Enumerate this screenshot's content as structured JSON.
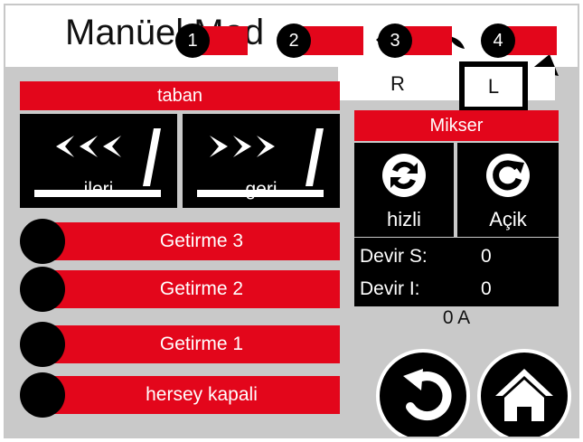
{
  "header": {
    "title": "Manüel Mod",
    "tabs": [
      {
        "label": "1"
      },
      {
        "label": "2"
      },
      {
        "label": "3"
      },
      {
        "label": "4"
      }
    ],
    "r_label": "R",
    "l_label": "L"
  },
  "taban": {
    "title": "taban",
    "ileri_label": "ileri",
    "geri_label": "geri"
  },
  "getirme": [
    {
      "label": "Getirme 3"
    },
    {
      "label": "Getirme 2"
    },
    {
      "label": "Getirme 1"
    },
    {
      "label": "hersey kapali"
    }
  ],
  "mikser": {
    "title": "Mikser",
    "hizli_label": "hizli",
    "acik_label": "Açik",
    "devir_s_label": "Devir S:",
    "devir_s_value": "0",
    "devir_i_label": "Devir I:",
    "devir_i_value": "0",
    "current": "0 A"
  },
  "colors": {
    "accent_red": "#e3061b",
    "panel_bg": "#c9c9c9",
    "black": "#000000"
  },
  "icons": {
    "back": "undo-arrow-icon",
    "home": "home-icon"
  }
}
